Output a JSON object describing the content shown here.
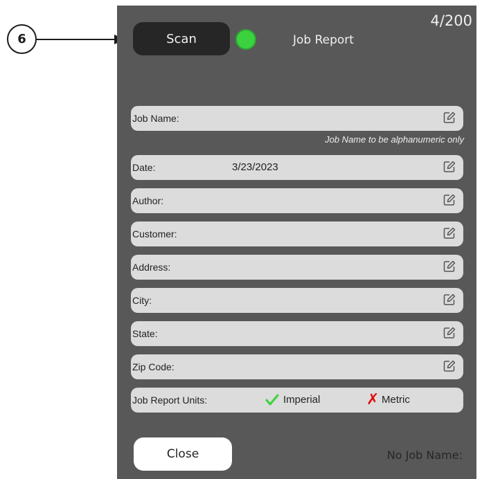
{
  "callout": {
    "number": "6"
  },
  "header": {
    "scan_label": "Scan",
    "status_color": "#3bd13f",
    "title": "Job Report",
    "counter": "4/200"
  },
  "form": {
    "hint": "Job Name to be alphanumeric only",
    "fields": [
      {
        "label": "Job Name:",
        "value": ""
      },
      {
        "label": "Date:",
        "value": "3/23/2023"
      },
      {
        "label": "Author:",
        "value": ""
      },
      {
        "label": "Customer:",
        "value": ""
      },
      {
        "label": "Address:",
        "value": ""
      },
      {
        "label": "City:",
        "value": ""
      },
      {
        "label": "State:",
        "value": ""
      },
      {
        "label": "Zip Code:",
        "value": ""
      }
    ],
    "units": {
      "label": "Job Report Units:",
      "imperial": "Imperial",
      "imperial_icon": "green-checkmark-icon",
      "metric": "Metric",
      "metric_icon": "red-x-icon",
      "x_glyph": "✗"
    }
  },
  "footer": {
    "close_label": "Close",
    "status_text": "No Job Name:"
  },
  "colors": {
    "panel_bg": "#585858",
    "field_bg": "#dcdcdc",
    "accent_green": "#3bd13f",
    "accent_red": "#e10d0d"
  }
}
